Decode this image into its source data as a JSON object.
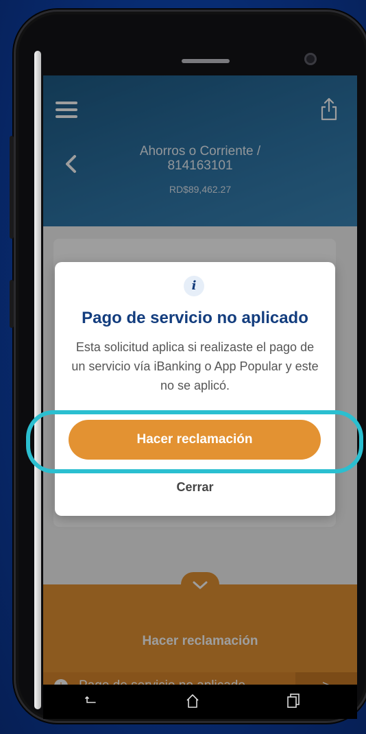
{
  "header": {
    "account_title": "Ahorros o Corriente / 814163101",
    "balance": "RD$89,462.27"
  },
  "dialog": {
    "title": "Pago de servicio no aplicado",
    "message": "Esta solicitud aplica si realizaste el pago de un servicio vía iBanking o App Popular y este no se aplicó.",
    "primary_button": "Hacer reclamación",
    "close_button": "Cerrar"
  },
  "bottom_bar": {
    "label": "Hacer reclamación",
    "row_text": "Pago de servicio no aplicado",
    "row_chevron": ">"
  },
  "icons": {
    "info": "info-icon",
    "menu": "hamburger-menu-icon",
    "share": "share-icon",
    "back": "back-chevron-icon"
  },
  "colors": {
    "accent": "#e39232",
    "title_blue": "#133d7e",
    "highlight": "#2bbfd0",
    "header_blue": "#2e76a8"
  }
}
